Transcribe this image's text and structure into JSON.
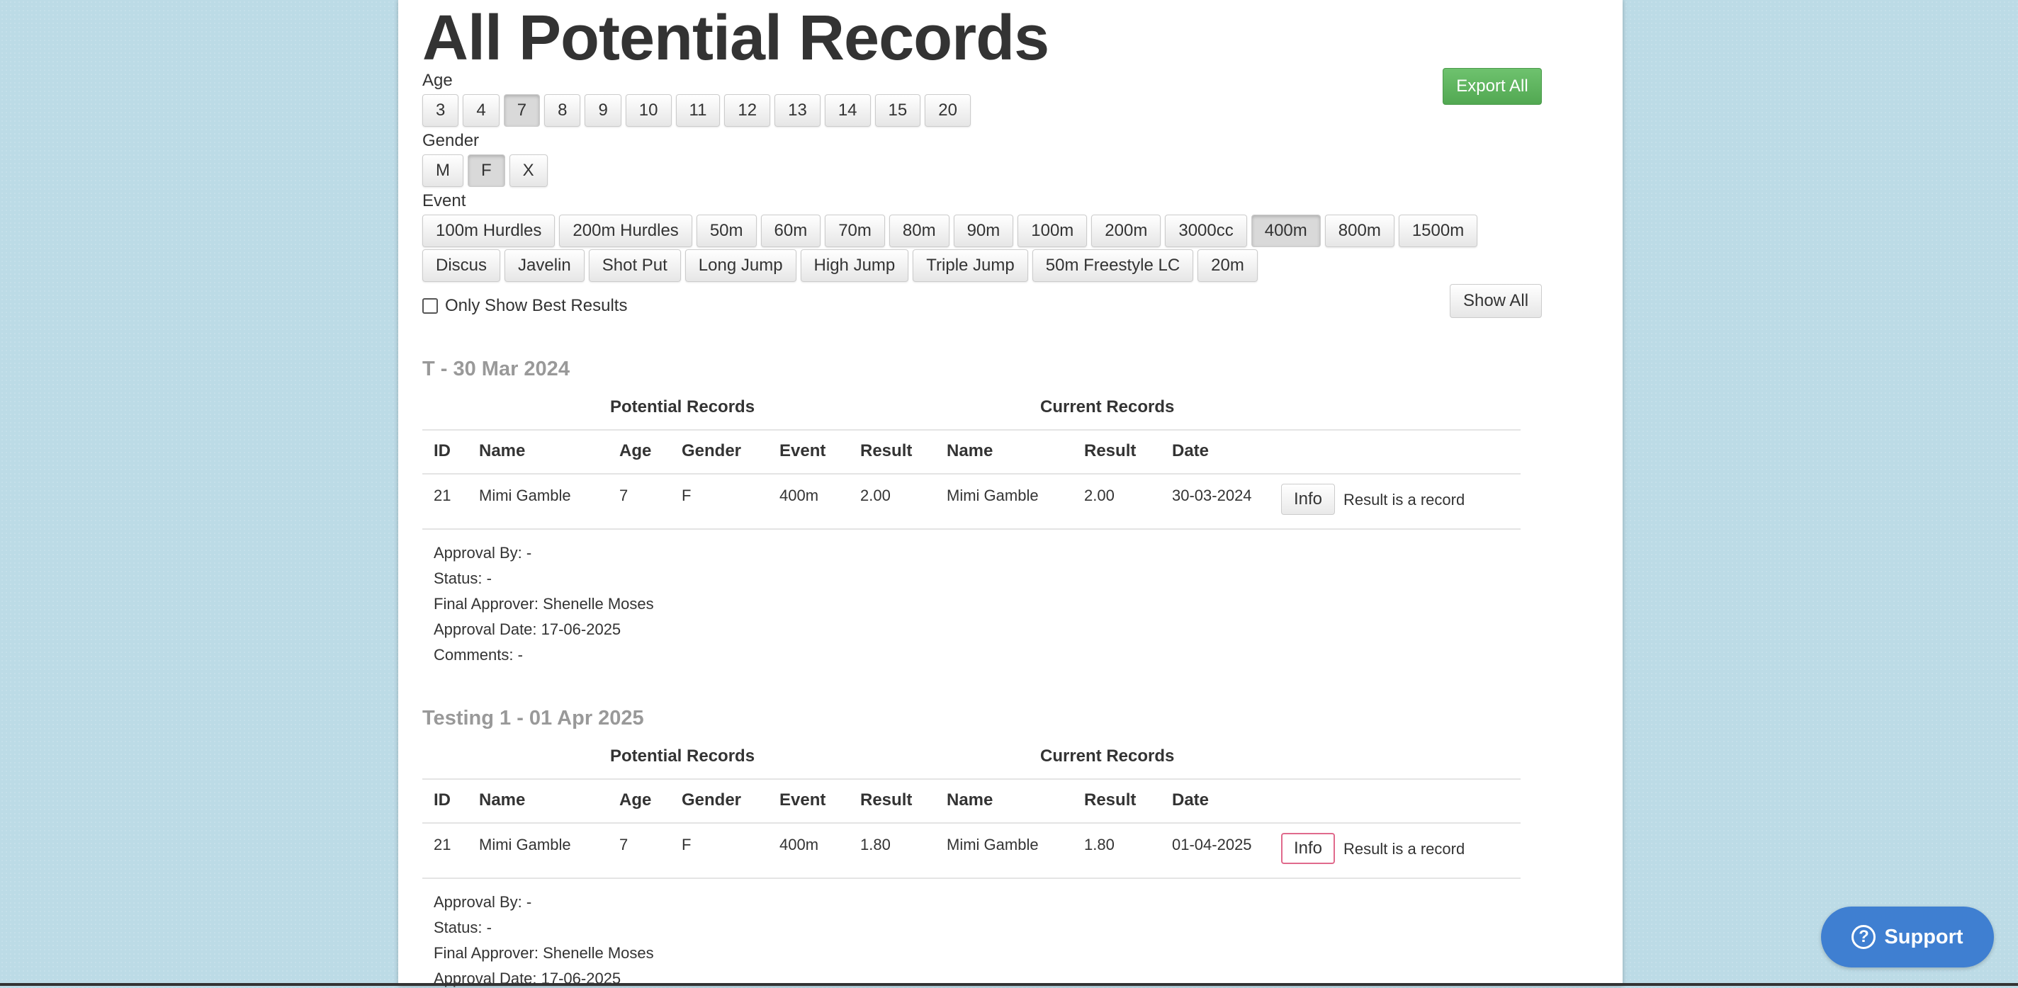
{
  "title": "All Potential Records",
  "filters": {
    "age_label": "Age",
    "ages": [
      "3",
      "4",
      "7",
      "8",
      "9",
      "10",
      "11",
      "12",
      "13",
      "14",
      "15",
      "20"
    ],
    "age_selected": "7",
    "gender_label": "Gender",
    "genders": [
      "M",
      "F",
      "X"
    ],
    "gender_selected": "F",
    "event_label": "Event",
    "events_row1": [
      "100m Hurdles",
      "200m Hurdles",
      "50m",
      "60m",
      "70m",
      "80m",
      "90m",
      "100m",
      "200m",
      "3000cc",
      "400m",
      "800m",
      "1500m"
    ],
    "events_row2": [
      "Discus",
      "Javelin",
      "Shot Put",
      "Long Jump",
      "High Jump",
      "Triple Jump",
      "50m Freestyle LC",
      "20m"
    ],
    "event_selected": "400m",
    "only_best_label": "Only Show Best Results"
  },
  "buttons": {
    "export_all": "Export All",
    "show_all": "Show All",
    "support": "Support"
  },
  "table_headers": {
    "potential": "Potential Records",
    "current": "Current Records",
    "id": "ID",
    "name": "Name",
    "age": "Age",
    "gender": "Gender",
    "event": "Event",
    "result": "Result",
    "cur_name": "Name",
    "cur_result": "Result",
    "date": "Date"
  },
  "meets": [
    {
      "title": "T - 30 Mar 2024",
      "row": {
        "id": "21",
        "name": "Mimi Gamble",
        "age": "7",
        "gender": "F",
        "event": "400m",
        "result": "2.00",
        "cur_name": "Mimi Gamble",
        "cur_result": "2.00",
        "date": "30-03-2024",
        "info": "Info",
        "status": "Result is a record"
      },
      "details": [
        "Approval By: -",
        "Status: -",
        "Final Approver: Shenelle Moses",
        "Approval Date: 17-06-2025",
        "Comments: -"
      ]
    },
    {
      "title": "Testing 1 - 01 Apr 2025",
      "row": {
        "id": "21",
        "name": "Mimi Gamble",
        "age": "7",
        "gender": "F",
        "event": "400m",
        "result": "1.80",
        "cur_name": "Mimi Gamble",
        "cur_result": "1.80",
        "date": "01-04-2025",
        "info": "Info",
        "status": "Result is a record"
      },
      "details": [
        "Approval By: -",
        "Status: -",
        "Final Approver: Shenelle Moses",
        "Approval Date: 17-06-2025"
      ]
    }
  ]
}
